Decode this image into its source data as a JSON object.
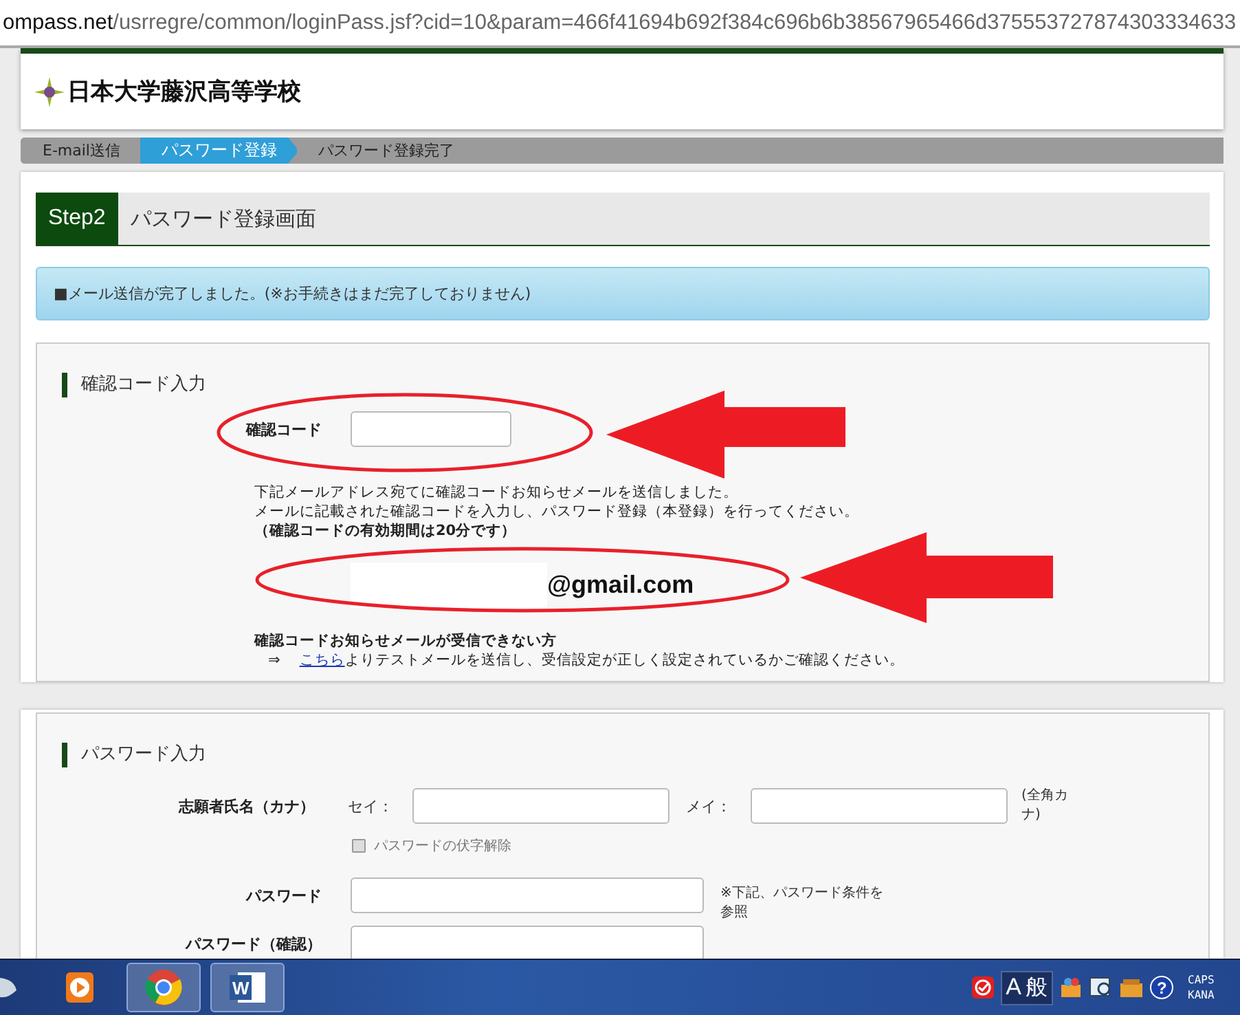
{
  "address_bar": {
    "url_host": "ompass.net",
    "url_path": "/usrregre/common/loginPass.jsf?cid=10&param=466f41694b692f384c696b6b38567965466d375553727874303334633"
  },
  "header": {
    "school_name": "日本大学藤沢高等学校"
  },
  "steps": [
    {
      "label": "E-mail送信",
      "selected": false
    },
    {
      "label": "パスワード登録",
      "selected": true
    },
    {
      "label": "パスワード登録完了",
      "selected": false
    }
  ],
  "page_title": {
    "step": "Step2",
    "title": "パスワード登録画面"
  },
  "notice": "■メール送信が完了しました。(※お手続きはまだ完了しておりません)",
  "code_section": {
    "heading": "確認コード入力",
    "field_label": "確認コード",
    "message_lines": [
      "下記メールアドレス宛てに確認コードお知らせメールを送信しました。",
      "メールに記載された確認コードを入力し、パスワード登録（本登録）を行ってください。"
    ],
    "note": "（確認コードの有効期間は20分です）",
    "email": "@gmail.com",
    "help_title": "確認コードお知らせメールが受信できない方",
    "help_arrow": "⇒",
    "help_link": "こちら",
    "help_text": "よりテストメールを送信し、受信設定が正しく設定されているかご確認ください。"
  },
  "password_section": {
    "heading": "パスワード入力",
    "name_label": "志願者氏名（カナ）",
    "sei_label": "セイ：",
    "mei_label": "メイ：",
    "kana_note": "(全角カナ)",
    "unmask": {
      "label": "パスワードの伏字解除",
      "checked": false
    },
    "password_label": "パスワード",
    "password_note": "※下記、パスワード条件を参照",
    "confirm_label": "パスワード（確認）"
  },
  "taskbar": {
    "apps": [
      {
        "kind": "media",
        "selected": false
      },
      {
        "kind": "chrome",
        "selected": true
      },
      {
        "kind": "word",
        "selected": true,
        "label": "W"
      }
    ],
    "help_glyph": "?",
    "ime_mode": "A",
    "ime_kana": "般",
    "caps": "CAPS",
    "kana": "KANA"
  }
}
